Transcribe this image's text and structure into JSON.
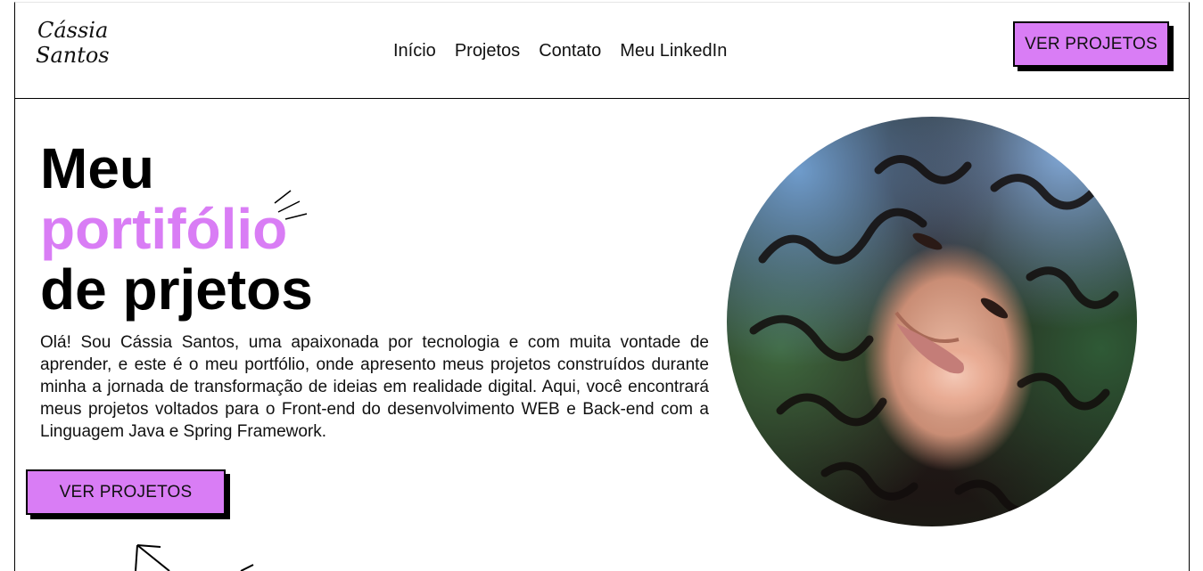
{
  "header": {
    "logo_line1": "Cássia",
    "logo_line2": "Santos",
    "nav": [
      "Início",
      "Projetos",
      "Contato",
      "Meu LinkedIn"
    ],
    "cta_label": "VER PROJETOS"
  },
  "hero": {
    "headline_line1": "Meu",
    "headline_line2": "portifólio",
    "headline_line3": "de prjetos",
    "intro": "Olá! Sou Cássia Santos, uma apaixonada por tecnologia e com muita vontade de aprender, e este é o meu portfólio, onde apresento meus projetos construídos durante minha a jornada de transformação de ideias em realidade digital. Aqui, você encontrará meus projetos voltados para o Front-end do desenvolvimento WEB e Back-end com a Linguagem Java e Spring Framework.",
    "cta_label": "VER PROJETOS"
  },
  "colors": {
    "accent": "#d97df5",
    "text": "#000000",
    "background": "#ffffff"
  },
  "icons": {
    "decoration": "sparkle-lines-icon",
    "arrow": "arrow-icon"
  }
}
